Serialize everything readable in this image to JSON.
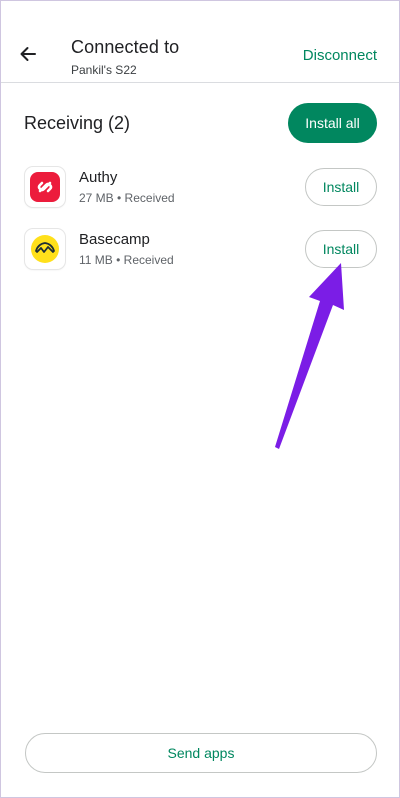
{
  "header": {
    "title": "Connected to",
    "subtitle": "Pankil's S22",
    "disconnect_label": "Disconnect"
  },
  "receiving": {
    "title": "Receiving (2)",
    "install_all_label": "Install all",
    "apps": [
      {
        "name": "Authy",
        "size": "27 MB",
        "status": "Received",
        "meta": "27 MB • Received",
        "install_label": "Install",
        "icon": "authy-logo-icon"
      },
      {
        "name": "Basecamp",
        "size": "11 MB",
        "status": "Received",
        "meta": "11 MB • Received",
        "install_label": "Install",
        "icon": "basecamp-logo-icon"
      }
    ]
  },
  "footer": {
    "send_apps_label": "Send apps"
  },
  "colors": {
    "accent": "#01875f",
    "authy_red": "#ec1c3c",
    "basecamp_yellow": "#ffe01b",
    "annotation_arrow": "#7b1de6"
  }
}
